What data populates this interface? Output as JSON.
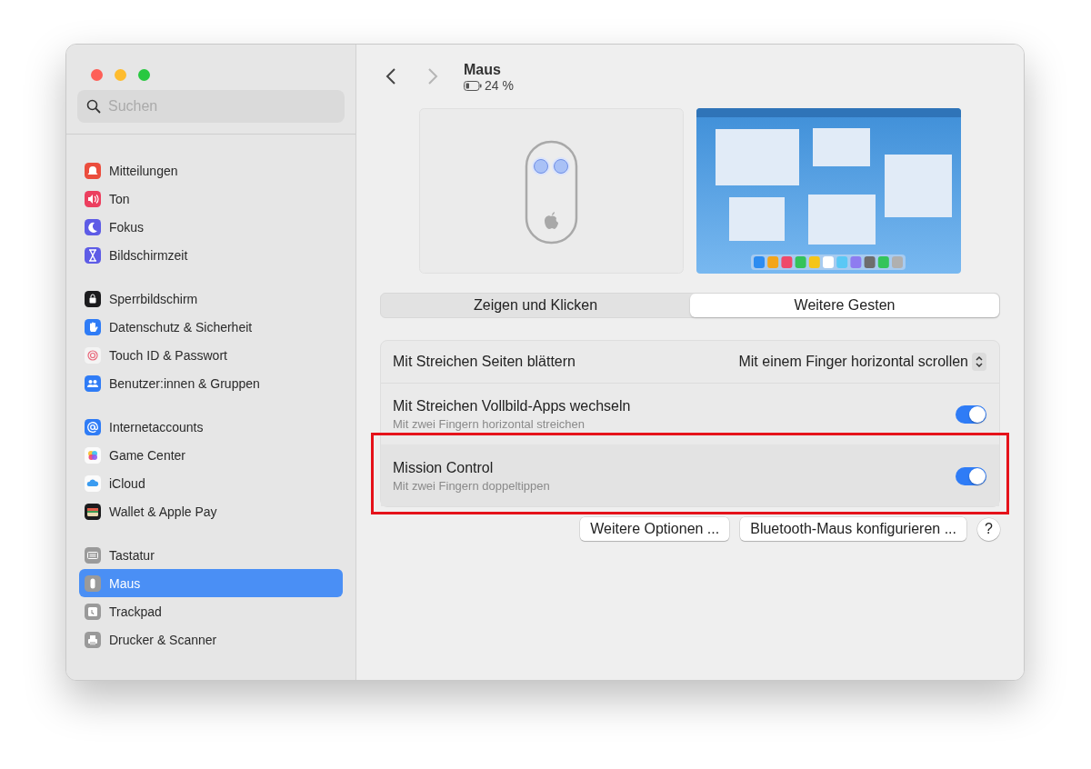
{
  "sidebar": {
    "search": {
      "placeholder": "Suchen"
    },
    "groups": [
      [
        {
          "label": "Mitteilungen",
          "color": "#eb4d3d",
          "selected": false
        },
        {
          "label": "Ton",
          "color": "#ec3f5f",
          "selected": false
        },
        {
          "label": "Fokus",
          "color": "#5e5ce6",
          "selected": false
        },
        {
          "label": "Bildschirmzeit",
          "color": "#5e5ce6",
          "selected": false
        }
      ],
      [
        {
          "label": "Sperrbildschirm",
          "color": "#1c1c1e",
          "selected": false
        },
        {
          "label": "Datenschutz & Sicherheit",
          "color": "#2f7cf6",
          "selected": false
        },
        {
          "label": "Touch ID & Passwort",
          "color": "#f4f4f4",
          "selected": false
        },
        {
          "label": "Benutzer:innen & Gruppen",
          "color": "#2f7cf6",
          "selected": false
        }
      ],
      [
        {
          "label": "Internetaccounts",
          "color": "#2f7cf6",
          "selected": false
        },
        {
          "label": "Game Center",
          "color": "#fbfbfb",
          "selected": false
        },
        {
          "label": "iCloud",
          "color": "#fbfbfb",
          "selected": false
        },
        {
          "label": "Wallet & Apple Pay",
          "color": "#1c1c1e",
          "selected": false
        }
      ],
      [
        {
          "label": "Tastatur",
          "color": "#9a9a9a",
          "selected": false
        },
        {
          "label": "Maus",
          "color": "#9a9a9a",
          "selected": true
        },
        {
          "label": "Trackpad",
          "color": "#9a9a9a",
          "selected": false
        },
        {
          "label": "Drucker & Scanner",
          "color": "#9a9a9a",
          "selected": false
        }
      ]
    ]
  },
  "header": {
    "back_enabled": true,
    "forward_enabled": false,
    "title": "Maus",
    "battery": "24 %"
  },
  "tabs": [
    {
      "label": "Zeigen und Klicken",
      "selected": false
    },
    {
      "label": "Weitere Gesten",
      "selected": true
    }
  ],
  "settings": [
    {
      "kind": "popup",
      "label": "Mit Streichen Seiten blättern",
      "value": "Mit einem Finger horizontal scrollen",
      "highlighted": false
    },
    {
      "kind": "toggle",
      "label": "Mit Streichen Vollbild-Apps wechseln",
      "subtitle": "Mit zwei Fingern horizontal streichen",
      "on": true,
      "highlighted": false
    },
    {
      "kind": "toggle",
      "label": "Mission Control",
      "subtitle": "Mit zwei Fingern doppeltippen",
      "on": true,
      "highlighted": true
    }
  ],
  "buttons": [
    "Weitere Optionen ...",
    "Bluetooth-Maus konfigurieren ..."
  ],
  "help": "?"
}
